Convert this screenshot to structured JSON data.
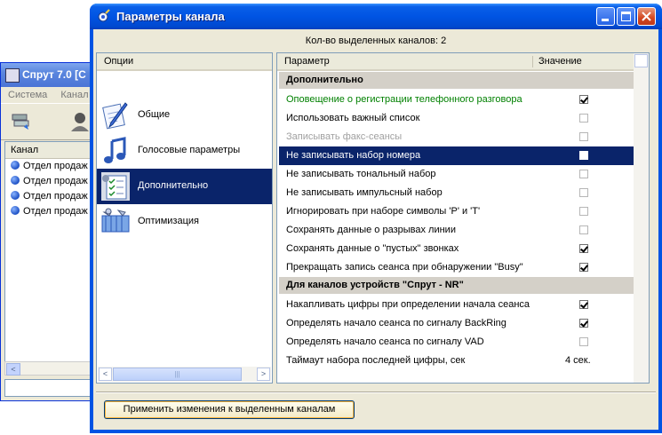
{
  "background_window": {
    "title": "Спрут 7.0 [С",
    "menu": [
      "Система",
      "Канал"
    ],
    "list_header": "Канал",
    "channels": [
      "Отдел продаж",
      "Отдел продаж",
      "Отдел продаж",
      "Отдел продаж"
    ]
  },
  "dialog": {
    "title": "Параметры канала",
    "selected_count": "Кол-во выделенных каналов: 2",
    "options_header": "Опции",
    "options": [
      {
        "label": "Общие",
        "icon": "pen-notepad-icon"
      },
      {
        "label": "Голосовые параметры",
        "icon": "music-note-icon"
      },
      {
        "label": "Дополнительно",
        "icon": "checklist-icon"
      },
      {
        "label": "Оптимизация",
        "icon": "tools-icon"
      }
    ],
    "selected_option": 2,
    "params_header": {
      "param": "Параметр",
      "value": "Значение"
    },
    "sections": [
      {
        "title": "Дополнительно",
        "rows": [
          {
            "label": "Оповещение о регистрации телефонного разговора",
            "checked": true,
            "style": "green"
          },
          {
            "label": "Использовать важный список",
            "checked": false
          },
          {
            "label": "Записывать факс-сеансы",
            "checked": false,
            "style": "disabled"
          },
          {
            "label": "Не записывать набор номера",
            "checked": false,
            "style": "selected"
          },
          {
            "label": "Не записывать тональный набор",
            "checked": false
          },
          {
            "label": "Не записывать импульсный набор",
            "checked": false
          },
          {
            "label": "Игнорировать при наборе символы 'P' и 'T'",
            "checked": false
          },
          {
            "label": "Сохранять данные о разрывах линии",
            "checked": false
          },
          {
            "label": "Сохранять данные о \"пустых\" звонках",
            "checked": true
          },
          {
            "label": "Прекращать запись сеанса при обнаружении \"Busy\"",
            "checked": true
          }
        ]
      },
      {
        "title": "Для каналов устройств \"Спрут - NR\"",
        "rows": [
          {
            "label": "Накапливать цифры при определении начала сеанса",
            "checked": true
          },
          {
            "label": "Определять начало сеанса по сигналу BackRing",
            "checked": true
          },
          {
            "label": "Определять начало сеанса по сигналу VAD",
            "checked": false
          },
          {
            "label": "Таймаут набора последней цифры, сек",
            "value": "4 сек."
          }
        ]
      }
    ],
    "apply_button": "Применить изменения к выделенным каналам"
  },
  "colors": {
    "title_bar": "#0054e3",
    "selection": "#0a246a",
    "section_bg": "#d4d0c8",
    "highlight_text": "#008000"
  }
}
